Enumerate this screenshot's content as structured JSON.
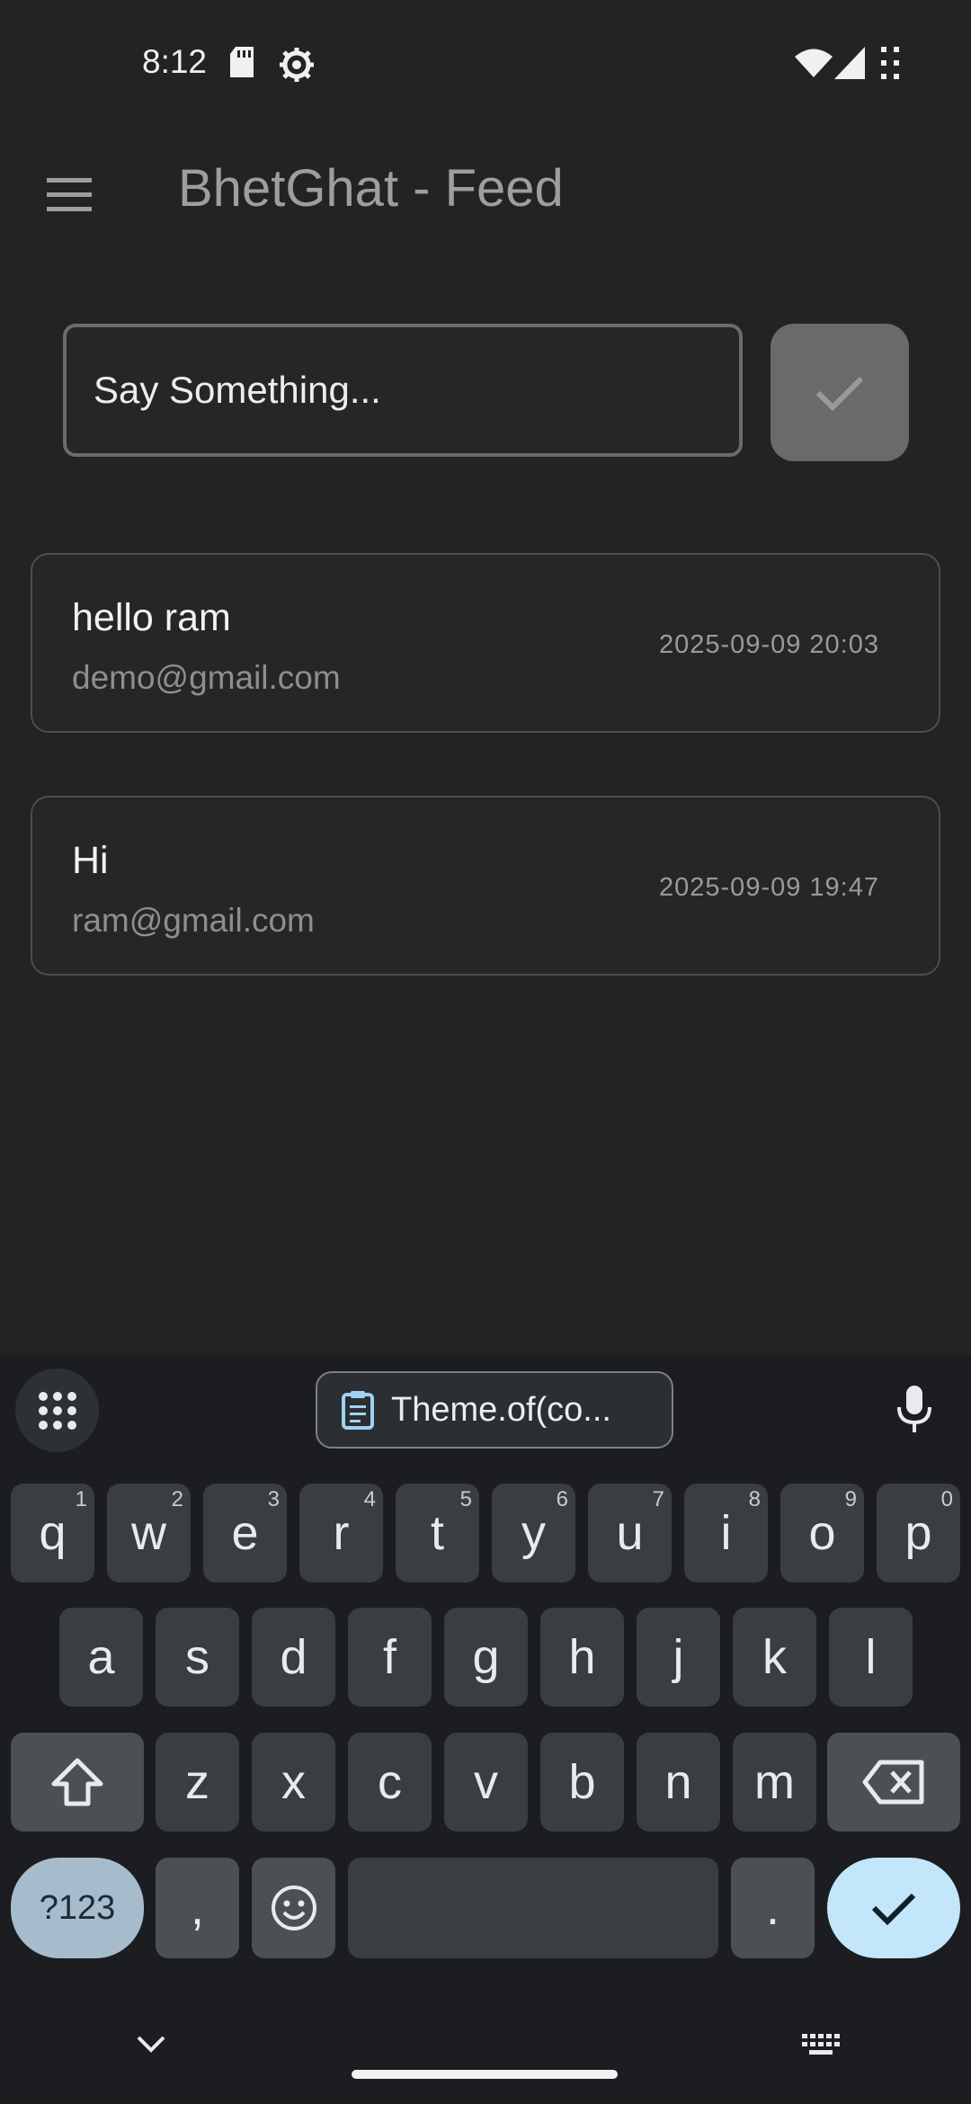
{
  "status_bar": {
    "time": "8:12"
  },
  "app_bar": {
    "title": "BhetGhat - Feed"
  },
  "composer": {
    "placeholder": "Say Something..."
  },
  "feed": [
    {
      "message": "hello ram",
      "email": "demo@gmail.com",
      "time": "2025-09-09 20:03"
    },
    {
      "message": "Hi",
      "email": "ram@gmail.com",
      "time": "2025-09-09 19:47"
    }
  ],
  "keyboard": {
    "clipboard_chip": "Theme.of(co...",
    "row1": [
      {
        "key": "q",
        "hint": "1"
      },
      {
        "key": "w",
        "hint": "2"
      },
      {
        "key": "e",
        "hint": "3"
      },
      {
        "key": "r",
        "hint": "4"
      },
      {
        "key": "t",
        "hint": "5"
      },
      {
        "key": "y",
        "hint": "6"
      },
      {
        "key": "u",
        "hint": "7"
      },
      {
        "key": "i",
        "hint": "8"
      },
      {
        "key": "o",
        "hint": "9"
      },
      {
        "key": "p",
        "hint": "0"
      }
    ],
    "row2": [
      "a",
      "s",
      "d",
      "f",
      "g",
      "h",
      "j",
      "k",
      "l"
    ],
    "row3": [
      "z",
      "x",
      "c",
      "v",
      "b",
      "n",
      "m"
    ],
    "symbols_label": "?123",
    "comma": ",",
    "period": "."
  }
}
